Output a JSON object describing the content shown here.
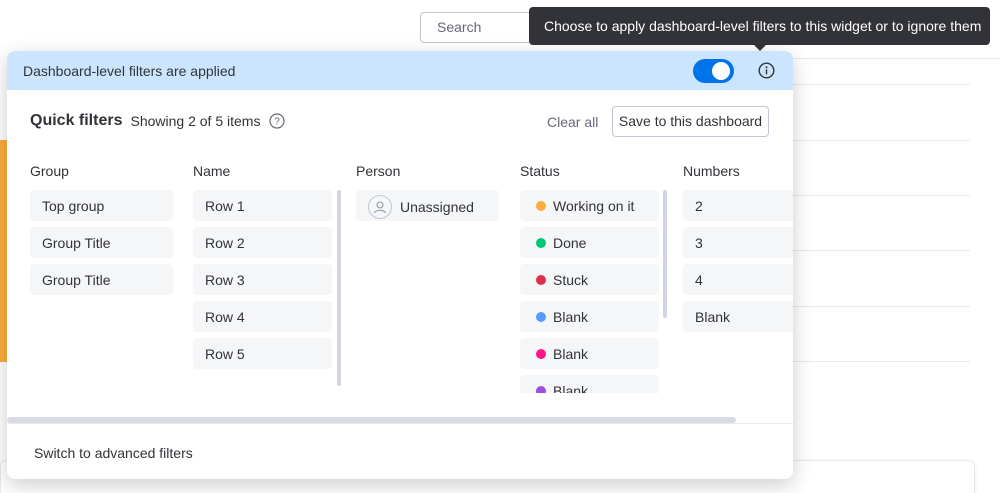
{
  "background": {
    "search_placeholder": "Search"
  },
  "tooltip": {
    "text": "Choose to apply dashboard-level filters to this widget or to ignore them"
  },
  "panel": {
    "header_text": "Dashboard-level filters are applied",
    "toggle_on": true,
    "quick_filters_title": "Quick filters",
    "showing_text": "Showing 2 of 5 items",
    "clear_all": "Clear all",
    "save_button": "Save to this dashboard",
    "footer_link": "Switch to advanced filters",
    "columns": {
      "group": {
        "header": "Group",
        "items": [
          "Top group",
          "Group Title",
          "Group Title"
        ]
      },
      "name": {
        "header": "Name",
        "items": [
          "Row 1",
          "Row 2",
          "Row 3",
          "Row 4",
          "Row 5"
        ]
      },
      "person": {
        "header": "Person",
        "items": [
          "Unassigned"
        ]
      },
      "status": {
        "header": "Status",
        "items": [
          {
            "label": "Working on it",
            "color": "#fdab3d"
          },
          {
            "label": "Done",
            "color": "#00c875"
          },
          {
            "label": "Stuck",
            "color": "#df2f4a"
          },
          {
            "label": "Blank",
            "color": "#579bfc"
          },
          {
            "label": "Blank",
            "color": "#ff158a"
          },
          {
            "label": "Blank",
            "color": "#9d50dd"
          }
        ]
      },
      "numbers": {
        "header": "Numbers",
        "items": [
          "2",
          "3",
          "4",
          "Blank"
        ]
      }
    }
  },
  "colors": {
    "accent": "#0073ea",
    "header_bg": "#cce5ff",
    "tooltip_bg": "#323338",
    "chip_bg": "#f5f6f8"
  }
}
